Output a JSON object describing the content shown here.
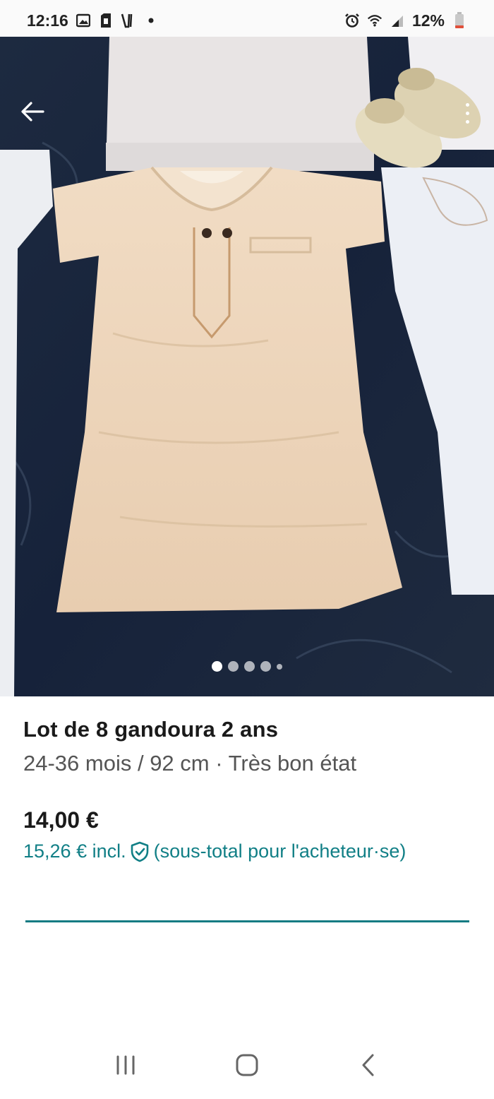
{
  "status_bar": {
    "time": "12:16",
    "battery": "12%",
    "icons": [
      "gallery-icon",
      "sim-icon",
      "v-logo-icon",
      "notification-dot-icon",
      "alarm-icon",
      "wifi-icon",
      "signal-icon",
      "battery-icon"
    ]
  },
  "photo": {
    "carousel_total": 5,
    "carousel_active": 1
  },
  "listing": {
    "title": "Lot de 8 gandoura 2 ans",
    "details": "24-36 mois / 92 cm · Très bon état",
    "price": "14,00 €",
    "price_incl_amount": "15,26 € incl.",
    "price_incl_note": "(sous-total pour l'acheteur·se)"
  },
  "colors": {
    "accent": "#117f86",
    "divider": "#137b83"
  },
  "nav": {
    "icons": [
      "recent-apps-icon",
      "home-icon",
      "back-icon"
    ]
  }
}
